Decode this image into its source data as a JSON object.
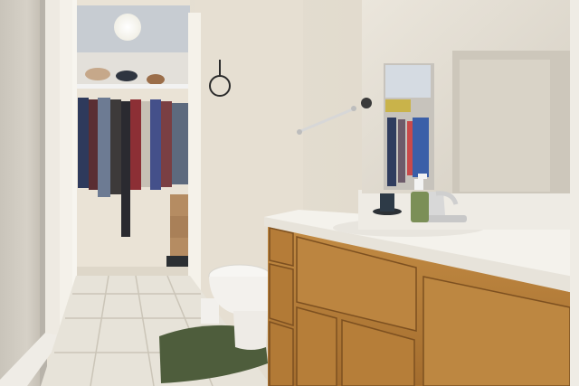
{
  "scene": {
    "description_kind": "photo",
    "palette": {
      "wall": "#e8e2d6",
      "wall_shadow": "#d2cbbd",
      "ceiling": "#cfd3d8",
      "closet_wall": "#ece4d7",
      "floor_tile": "#e6e2d8",
      "grout": "#c9c3b6",
      "cabinet_wood": "#b7823d",
      "cabinet_dark": "#8a5a24",
      "counter": "#f5f3ee",
      "rug": "#4f5e3d",
      "shower_glass": "#cfcac0",
      "mirror": "#e2ddd3",
      "soap": "#7a8f54"
    }
  }
}
